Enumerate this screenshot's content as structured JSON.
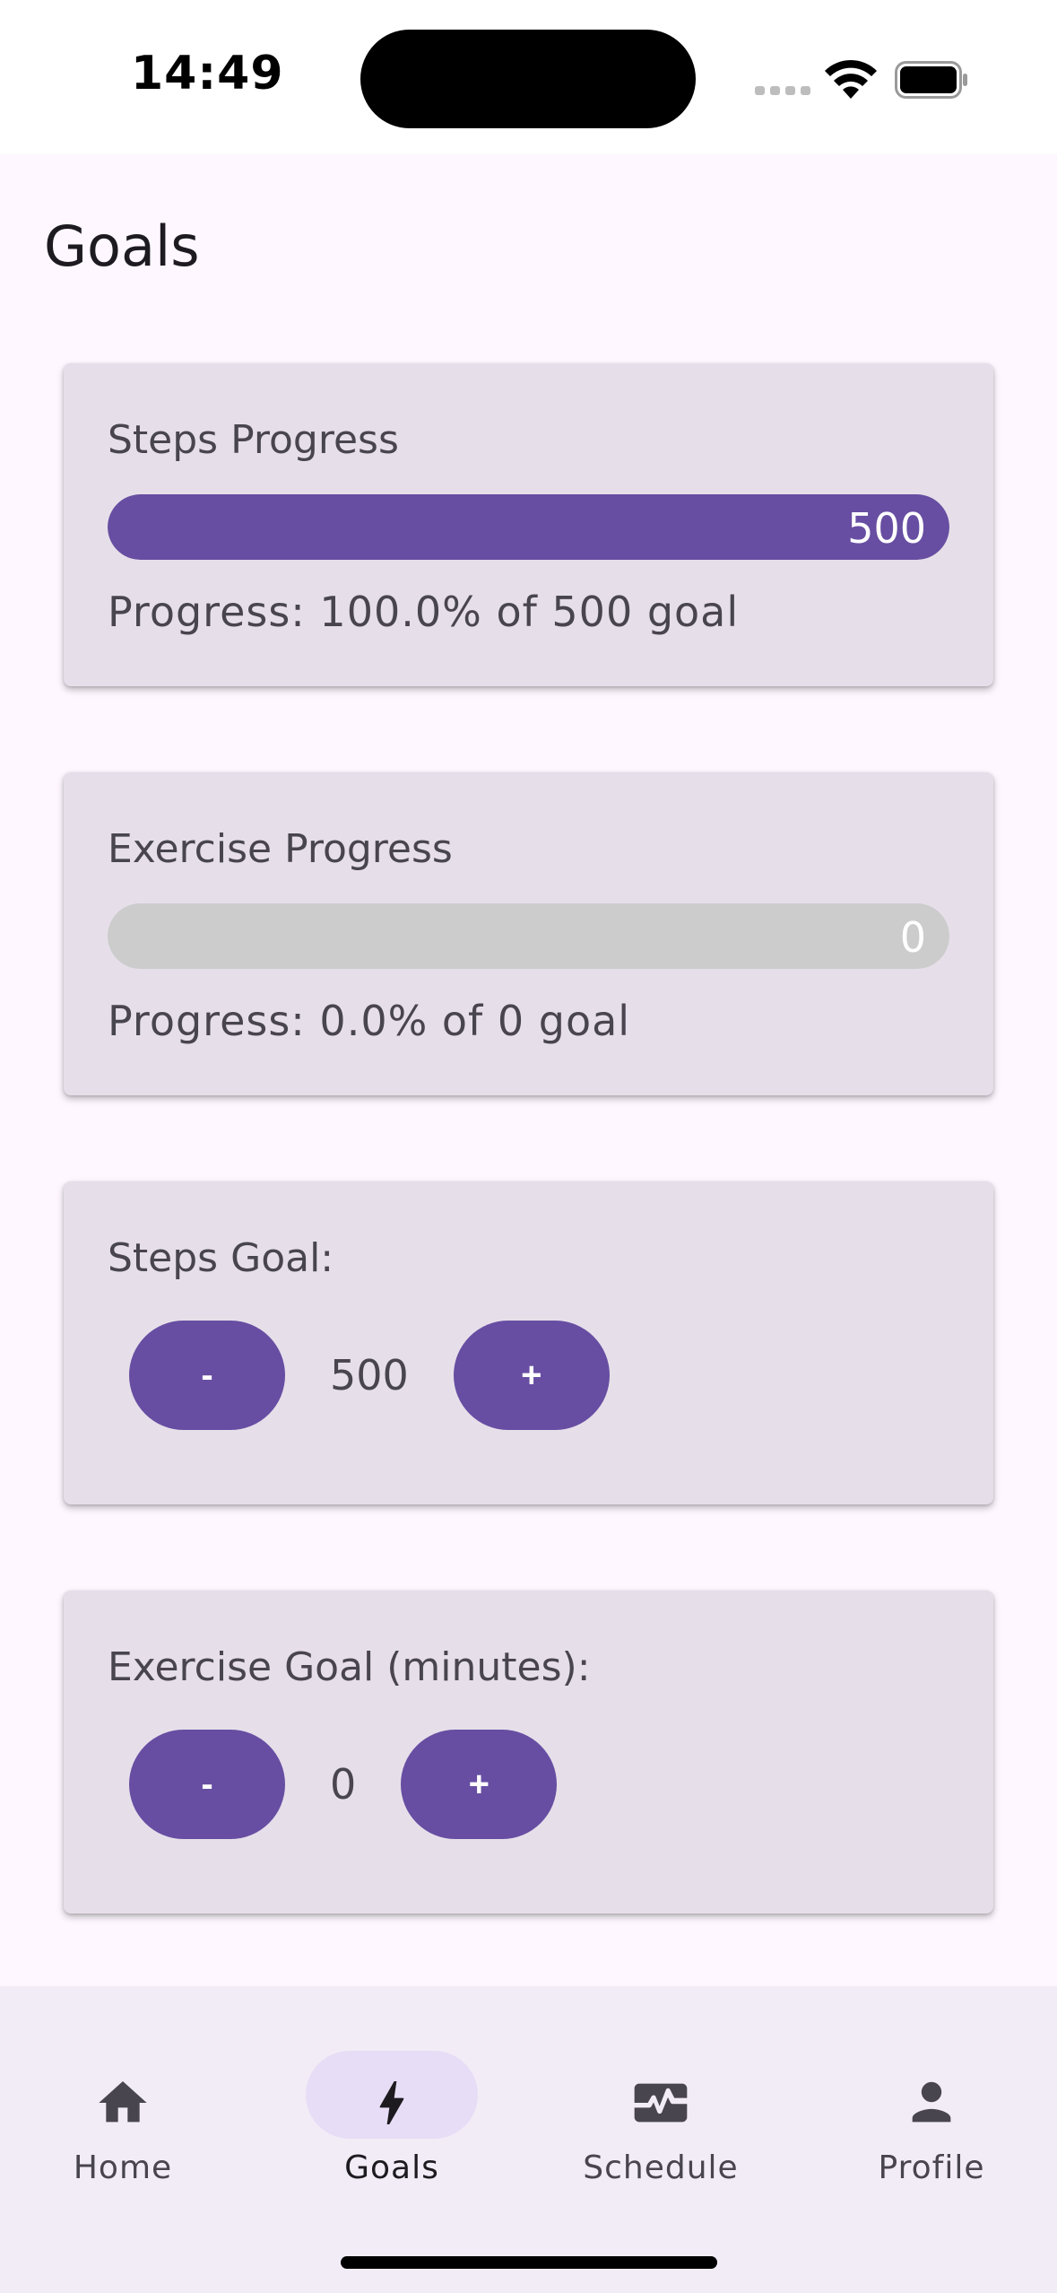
{
  "status_bar": {
    "time": "14:49",
    "icons": [
      "cellular-signal-icon",
      "wifi-icon",
      "battery-icon"
    ]
  },
  "page": {
    "title": "Goals"
  },
  "cards": {
    "steps_progress": {
      "title": "Steps Progress",
      "bar_label": "500",
      "fill_fraction": 1.0,
      "progress_text": "Progress: 100.0% of 500 goal"
    },
    "exercise_progress": {
      "title": "Exercise Progress",
      "bar_label": "0",
      "fill_fraction": 0.0,
      "progress_text": "Progress: 0.0% of 0 goal"
    },
    "steps_goal": {
      "title": "Steps Goal:",
      "minus_label": "-",
      "value": "500",
      "plus_label": "+"
    },
    "exercise_goal": {
      "title": "Exercise Goal (minutes):",
      "minus_label": "-",
      "value": "0",
      "plus_label": "+"
    }
  },
  "bottom_nav": {
    "items": [
      {
        "label": "Home",
        "icon": "home-icon",
        "active": false
      },
      {
        "label": "Goals",
        "icon": "bolt-icon",
        "active": true
      },
      {
        "label": "Schedule",
        "icon": "monitor-heart-icon",
        "active": false
      },
      {
        "label": "Profile",
        "icon": "person-icon",
        "active": false
      }
    ]
  },
  "colors": {
    "accent": "#674ea2",
    "card_background": "#e6dfea",
    "bar_track": "#cccccc",
    "page_background": "#fef7ff",
    "nav_background": "#f2ecf6",
    "nav_active_pill": "#e7ddf6"
  }
}
